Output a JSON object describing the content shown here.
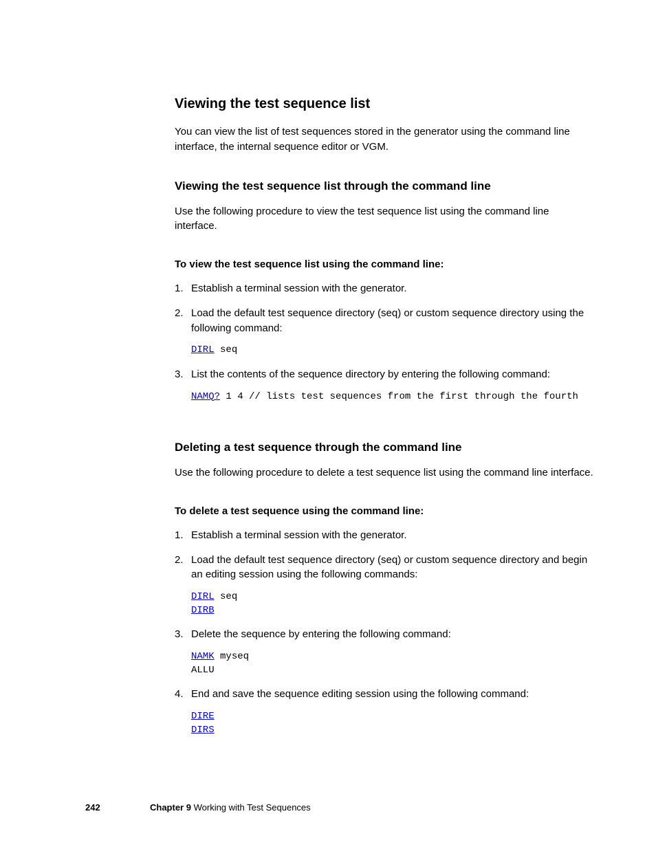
{
  "section1": {
    "title": "Viewing the test sequence list",
    "intro": "You can view the list of test sequences stored in the generator using the command line interface, the internal sequence editor or VGM."
  },
  "sub1": {
    "title": "Viewing the test sequence list through the command line",
    "intro": "Use the following procedure to view the test sequence list using the command line interface.",
    "proc_heading": "To view the test sequence list using the command line:",
    "step1": "Establish a terminal session with the generator.",
    "step2": "Load the default test sequence directory (seq) or custom sequence directory using the following command:",
    "code2_cmd": "DIRL",
    "code2_rest": " seq",
    "step3": "List the contents of the sequence directory by entering the following command:",
    "code3_cmd": "NAMQ?",
    "code3_rest": " 1 4 // lists test sequences from the first through the fourth"
  },
  "section2": {
    "title": "Deleting a test sequence through the command line",
    "intro": "Use the following procedure to delete a test sequence list using the command line interface.",
    "proc_heading": "To delete a test sequence using the command line:",
    "step1": "Establish a terminal session with the generator.",
    "step2": "Load the default test sequence directory (seq) or custom sequence directory and begin an editing session using the following commands:",
    "code2a_cmd": "DIRL",
    "code2a_rest": " seq",
    "code2b_cmd": "DIRB",
    "step3": "Delete the sequence by entering the following command:",
    "code3a_cmd": "NAMK",
    "code3a_rest": " myseq",
    "code3b": "ALLU",
    "step4": "End and save the sequence editing session using the following command:",
    "code4a_cmd": "DIRE",
    "code4b_cmd": "DIRS"
  },
  "footer": {
    "pagenum": "242",
    "chapter_prefix": "Chapter 9",
    "chapter_title": "Working with Test Sequences"
  }
}
